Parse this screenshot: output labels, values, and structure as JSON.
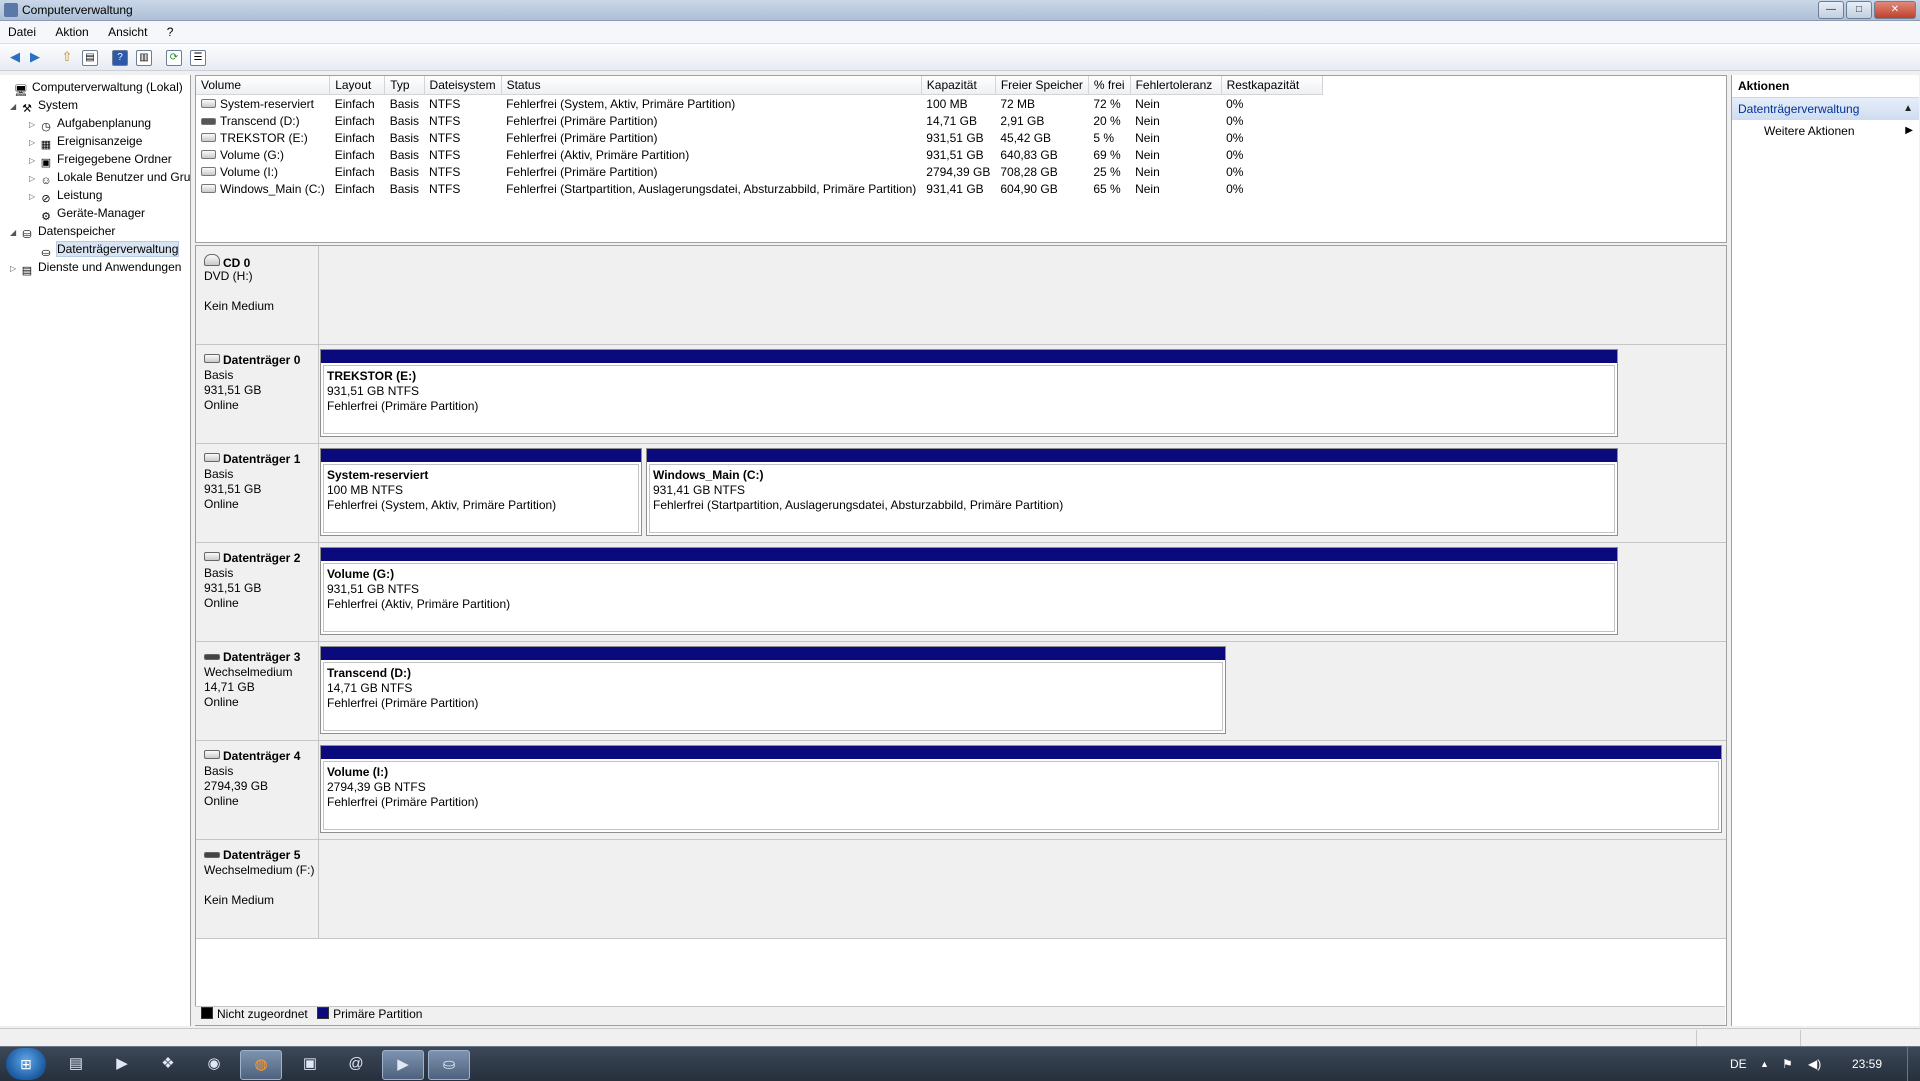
{
  "window": {
    "title": "Computerverwaltung",
    "controls": {
      "minimize": "—",
      "maximize": "□",
      "close": "✕"
    }
  },
  "menu": [
    "Datei",
    "Aktion",
    "Ansicht",
    "?"
  ],
  "toolbar": {
    "icons": [
      "back-arrow-icon",
      "forward-arrow-icon",
      "up-folder-icon",
      "show-hide-console-tree-icon",
      "help-icon",
      "show-hide-action-pane-icon",
      "refresh-icon",
      "properties-icon"
    ],
    "glyphs": {
      "back": "◀",
      "forward": "▶",
      "up": "⇧",
      "console": "▤",
      "help": "?",
      "pane": "▥",
      "refresh": "⟳",
      "properties": "☰"
    }
  },
  "tree": {
    "items": [
      {
        "label": "Computerverwaltung (Lokal)",
        "icon": "computer-management-icon",
        "glyph": "🖥",
        "exp": ""
      },
      {
        "label": "System",
        "icon": "system-tools-icon",
        "glyph": "⚒",
        "exp": "◢"
      },
      {
        "label": "Aufgabenplanung",
        "icon": "task-scheduler-icon",
        "glyph": "◷",
        "exp": "▷"
      },
      {
        "label": "Ereignisanzeige",
        "icon": "event-viewer-icon",
        "glyph": "▦",
        "exp": "▷"
      },
      {
        "label": "Freigegebene Ordner",
        "icon": "shared-folders-icon",
        "glyph": "▣",
        "exp": "▷"
      },
      {
        "label": "Lokale Benutzer und Gruppen",
        "icon": "local-users-icon",
        "glyph": "☺",
        "exp": "▷"
      },
      {
        "label": "Leistung",
        "icon": "performance-icon",
        "glyph": "⊘",
        "exp": "▷"
      },
      {
        "label": "Geräte-Manager",
        "icon": "device-manager-icon",
        "glyph": "⚙",
        "exp": ""
      },
      {
        "label": "Datenspeicher",
        "icon": "storage-icon",
        "glyph": "⛁",
        "exp": "◢"
      },
      {
        "label": "Datenträgerverwaltung",
        "icon": "disk-management-icon",
        "glyph": "⛀",
        "exp": ""
      },
      {
        "label": "Dienste und Anwendungen",
        "icon": "services-applications-icon",
        "glyph": "▤",
        "exp": "▷"
      }
    ]
  },
  "volumes": {
    "columns": [
      "Volume",
      "Layout",
      "Typ",
      "Dateisystem",
      "Status",
      "Kapazität",
      "Freier Speicher",
      "% frei",
      "Fehlertoleranz",
      "Restkapazität"
    ],
    "rows": [
      [
        "System-reserviert",
        "Einfach",
        "Basis",
        "NTFS",
        "Fehlerfrei (System, Aktiv, Primäre Partition)",
        "100 MB",
        "72 MB",
        "72 %",
        "Nein",
        "0%"
      ],
      [
        "Transcend (D:)",
        "Einfach",
        "Basis",
        "NTFS",
        "Fehlerfrei (Primäre Partition)",
        "14,71 GB",
        "2,91 GB",
        "20 %",
        "Nein",
        "0%"
      ],
      [
        "TREKSTOR (E:)",
        "Einfach",
        "Basis",
        "NTFS",
        "Fehlerfrei (Primäre Partition)",
        "931,51 GB",
        "45,42 GB",
        "5 %",
        "Nein",
        "0%"
      ],
      [
        "Volume (G:)",
        "Einfach",
        "Basis",
        "NTFS",
        "Fehlerfrei (Aktiv, Primäre Partition)",
        "931,51 GB",
        "640,83 GB",
        "69 %",
        "Nein",
        "0%"
      ],
      [
        "Volume (I:)",
        "Einfach",
        "Basis",
        "NTFS",
        "Fehlerfrei (Primäre Partition)",
        "2794,39 GB",
        "708,28 GB",
        "25 %",
        "Nein",
        "0%"
      ],
      [
        "Windows_Main (C:)",
        "Einfach",
        "Basis",
        "NTFS",
        "Fehlerfrei (Startpartition, Auslagerungsdatei, Absturzabbild, Primäre Partition)",
        "931,41 GB",
        "604,90 GB",
        "65 %",
        "Nein",
        "0%"
      ]
    ]
  },
  "disks": [
    {
      "name": "CD 0",
      "line2": "DVD (H:)",
      "line3": "",
      "line4": "Kein Medium",
      "partitions": []
    },
    {
      "name": "Datenträger 0",
      "line2": "Basis",
      "line3": "931,51 GB",
      "line4": "Online",
      "partitions": [
        {
          "name": "TREKSTOR  (E:)",
          "size": "931,51 GB NTFS",
          "status": "Fehlerfrei (Primäre Partition)"
        }
      ]
    },
    {
      "name": "Datenträger 1",
      "line2": "Basis",
      "line3": "931,51 GB",
      "line4": "Online",
      "partitions": [
        {
          "name": "System-reserviert",
          "size": "100 MB NTFS",
          "status": "Fehlerfrei (System, Aktiv, Primäre Partition)"
        },
        {
          "name": "Windows_Main  (C:)",
          "size": "931,41 GB NTFS",
          "status": "Fehlerfrei (Startpartition, Auslagerungsdatei, Absturzabbild, Primäre Partition)"
        }
      ]
    },
    {
      "name": "Datenträger 2",
      "line2": "Basis",
      "line3": "931,51 GB",
      "line4": "Online",
      "partitions": [
        {
          "name": "Volume  (G:)",
          "size": "931,51 GB NTFS",
          "status": "Fehlerfrei (Aktiv, Primäre Partition)"
        }
      ]
    },
    {
      "name": "Datenträger 3",
      "line2": "Wechselmedium",
      "line3": "14,71 GB",
      "line4": "Online",
      "partitions": [
        {
          "name": "Transcend  (D:)",
          "size": "14,71 GB NTFS",
          "status": "Fehlerfrei (Primäre Partition)"
        }
      ]
    },
    {
      "name": "Datenträger 4",
      "line2": "Basis",
      "line3": "2794,39 GB",
      "line4": "Online",
      "partitions": [
        {
          "name": "Volume  (I:)",
          "size": "2794,39 GB NTFS",
          "status": "Fehlerfrei (Primäre Partition)"
        }
      ]
    },
    {
      "name": "Datenträger 5",
      "line2": "Wechselmedium (F:)",
      "line3": "",
      "line4": "Kein Medium",
      "partitions": []
    }
  ],
  "legend": {
    "unallocated": {
      "label": "Nicht zugeordnet",
      "color": "#000000"
    },
    "primary": {
      "label": "Primäre Partition",
      "color": "#0b0a7d"
    }
  },
  "actions": {
    "title": "Aktionen",
    "section": "Datenträgerverwaltung",
    "more": "Weitere Aktionen"
  },
  "taskbar": {
    "start_glyph": "⊞",
    "apps": [
      {
        "name": "explorer",
        "glyph": "▤"
      },
      {
        "name": "media-player",
        "glyph": "▶"
      },
      {
        "name": "app-3",
        "glyph": "❖"
      },
      {
        "name": "app-4",
        "glyph": "◉"
      },
      {
        "name": "firefox",
        "glyph": "◍"
      },
      {
        "name": "app-6",
        "glyph": "▣"
      },
      {
        "name": "app-7",
        "glyph": "@"
      },
      {
        "name": "app-8",
        "glyph": "▶"
      },
      {
        "name": "computer-management",
        "glyph": "⛀"
      }
    ],
    "language": "DE",
    "clock": "23:59",
    "tray_glyphs": {
      "up": "▲",
      "flag": "⚑",
      "sound": "◀)"
    }
  }
}
